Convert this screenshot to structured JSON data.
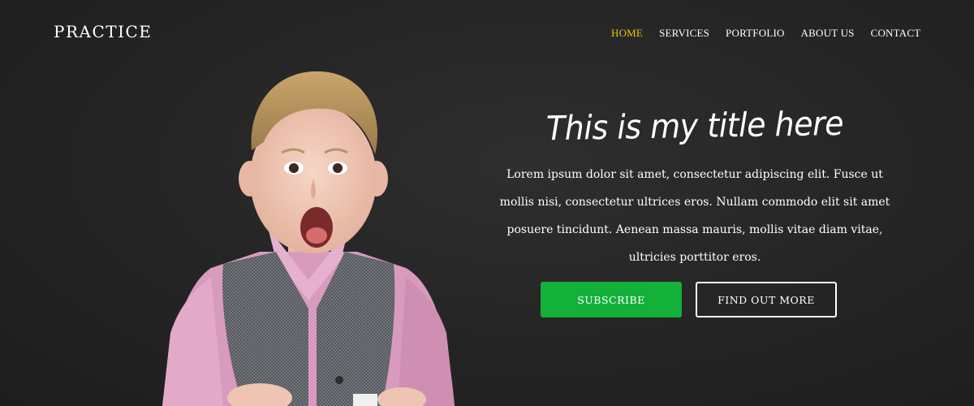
{
  "header": {
    "brand": "PRACTICE",
    "nav": [
      {
        "label": "HOME",
        "active": true
      },
      {
        "label": "SERVICES",
        "active": false
      },
      {
        "label": "PORTFOLIO",
        "active": false
      },
      {
        "label": "ABOUT US",
        "active": false
      },
      {
        "label": "CONTACT",
        "active": false
      }
    ],
    "active_color": "#e8c70f"
  },
  "hero": {
    "title": "This is my title here",
    "text": "Lorem ipsum dolor sit amet, consectetur adipiscing elit. Fusce ut mollis nisi, consectetur ultrices eros. Nullam commodo elit sit amet posuere tincidunt. Aenean massa mauris, mollis vitae diam vitae, ultricies porttitor eros.",
    "subscribe_label": "SUBSCRIBE",
    "find_out_label": "FIND OUT MORE",
    "subscribe_color": "#13b03a"
  },
  "image": {
    "subject": "surprised-child-photo"
  }
}
